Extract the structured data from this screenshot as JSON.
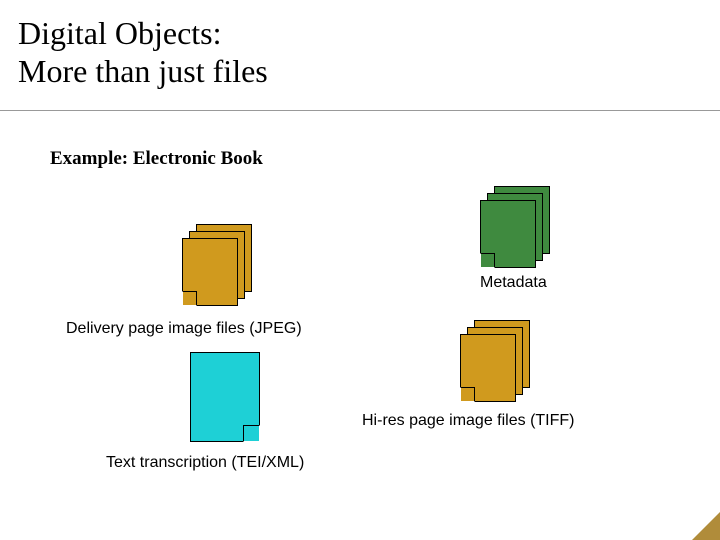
{
  "title_line1": "Digital Objects:",
  "title_line2": "More than just files",
  "subtitle": "Example: Electronic Book",
  "captions": {
    "metadata": "Metadata",
    "delivery": "Delivery page image files (JPEG)",
    "hires": "Hi-res page image files (TIFF)",
    "transcription": "Text transcription (TEI/XML)"
  },
  "colors": {
    "green": "#3f8a3f",
    "gold": "#d09a1e",
    "cyan": "#1ed0d6",
    "goldDark": "#b08c3a"
  }
}
